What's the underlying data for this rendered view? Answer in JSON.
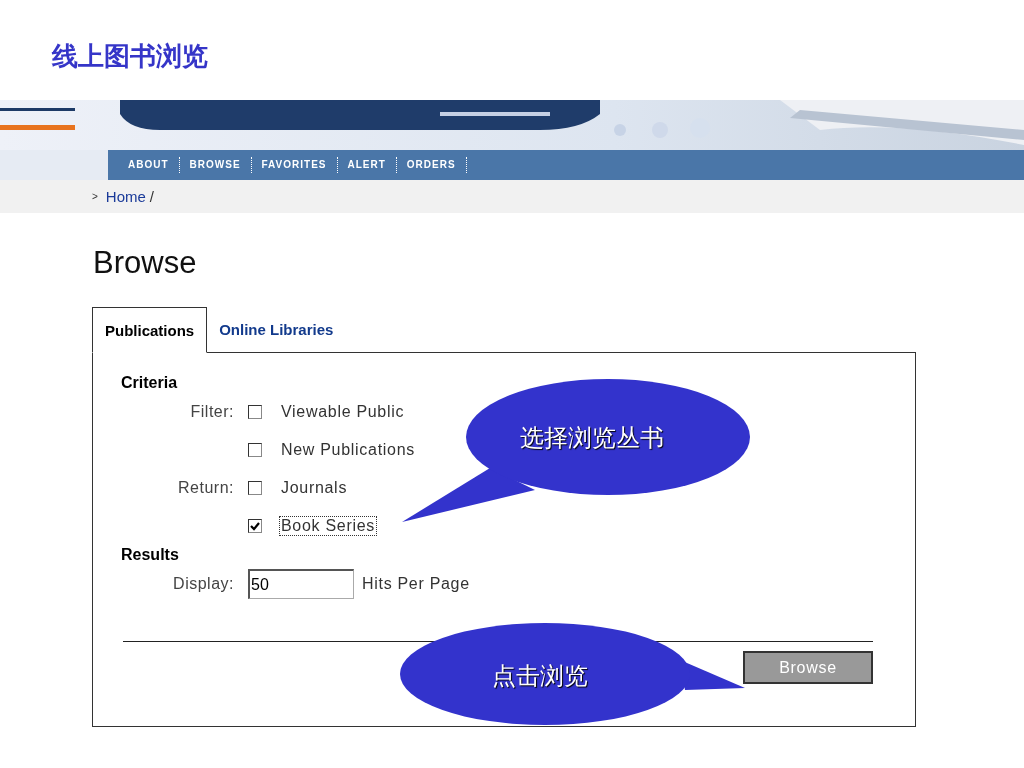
{
  "slide_title": "线上图书浏览",
  "nav": {
    "items": [
      "ABOUT",
      "BROWSE",
      "FAVORITES",
      "ALERT",
      "ORDERS"
    ]
  },
  "breadcrumb": {
    "marker": ">",
    "link": "Home",
    "trail": "/"
  },
  "heading": "Browse",
  "tabs": [
    {
      "label": "Publications",
      "selected": true
    },
    {
      "label": "Online Libraries",
      "selected": false
    }
  ],
  "criteria": {
    "title": "Criteria",
    "rows": [
      {
        "label": "Filter:",
        "option": "Viewable Public",
        "checked": false,
        "focused": false
      },
      {
        "option": "New Publications",
        "checked": false,
        "focused": false
      },
      {
        "label": "Return:",
        "option": "Journals",
        "checked": false,
        "focused": false
      },
      {
        "option": "Book Series",
        "checked": true,
        "focused": true
      }
    ]
  },
  "results": {
    "title": "Results",
    "label": "Display:",
    "value": "50",
    "suffix": "Hits Per Page"
  },
  "button": "Browse",
  "callouts": [
    {
      "text": "选择浏览丛书"
    },
    {
      "text": "点击浏览"
    }
  ]
}
